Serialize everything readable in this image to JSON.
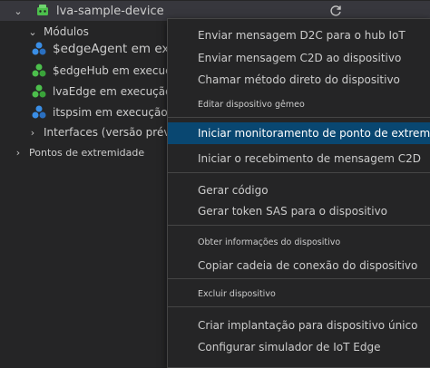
{
  "tree": {
    "device": "lva-sample-device",
    "modules_label": "Módulos",
    "modules": [
      {
        "name": "$edgeAgent em execução",
        "icon": "module-blue-icon",
        "color": "#3a8ee6"
      },
      {
        "name": "$edgeHub em execução",
        "icon": "module-green-icon",
        "color": "#4cbf4c"
      },
      {
        "name": "lvaEdge em execução",
        "icon": "module-green-icon",
        "color": "#4cbf4c"
      },
      {
        "name": "itspsim em execução",
        "icon": "module-blue-icon",
        "color": "#3a8ee6"
      }
    ],
    "interfaces": "Interfaces (versão prévia)",
    "endpoints": "Pontos de extremidade"
  },
  "menu": {
    "items": [
      {
        "label": "Enviar mensagem D2C para o hub IoT"
      },
      {
        "label": "Enviar mensagem C2D ao dispositivo"
      },
      {
        "label": "Chamar método direto do dispositivo"
      },
      {
        "label": "Editar dispositivo gêmeo"
      },
      {
        "label": "Iniciar monitoramento de ponto de extremidade de evento interno"
      },
      {
        "label": "Iniciar o recebimento de mensagem C2D"
      },
      {
        "label": "Gerar código"
      },
      {
        "label": "Gerar token SAS para o dispositivo"
      },
      {
        "label": "Obter informações do dispositivo"
      },
      {
        "label": "Copiar cadeia de conexão do dispositivo"
      },
      {
        "label": "Excluir dispositivo"
      },
      {
        "label": "Criar implantação para dispositivo único"
      },
      {
        "label": "Configurar simulador de IoT Edge"
      }
    ]
  },
  "colors": {
    "highlight": "#094771",
    "background": "#252526",
    "device_icon": "#4cbf4c"
  }
}
